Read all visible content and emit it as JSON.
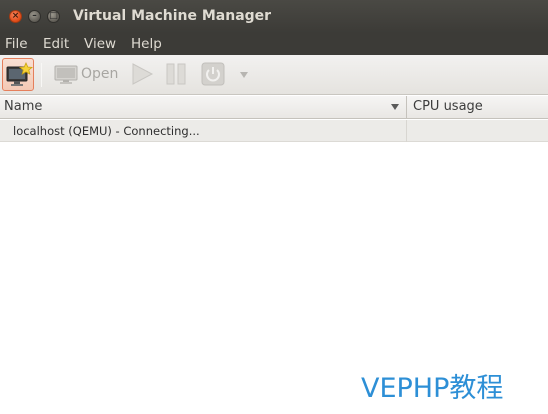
{
  "window": {
    "title": "Virtual Machine Manager",
    "controls": {
      "close": "×",
      "minimize": "–",
      "maximize": "□"
    }
  },
  "menubar": {
    "items": [
      {
        "label": "File"
      },
      {
        "label": "Edit"
      },
      {
        "label": "View"
      },
      {
        "label": "Help"
      }
    ]
  },
  "toolbar": {
    "new_icon": "new-vm-icon",
    "open_label": "Open",
    "open_icon": "monitor-icon",
    "run_icon": "play-icon",
    "pause_icon": "pause-icon",
    "shutdown_icon": "power-icon",
    "dropdown_icon": "chevron-down-icon"
  },
  "table": {
    "columns": [
      {
        "label": "Name"
      },
      {
        "label": "CPU usage"
      }
    ],
    "rows": [
      {
        "name": "localhost (QEMU) - Connecting...",
        "cpu": ""
      }
    ]
  },
  "watermark": {
    "text": "VEPHP教程"
  },
  "colors": {
    "titlebar": "#3c3b37",
    "close_button": "#df4a16",
    "selected_tool": "#f3c9b5",
    "watermark": "#2d8fd6"
  }
}
